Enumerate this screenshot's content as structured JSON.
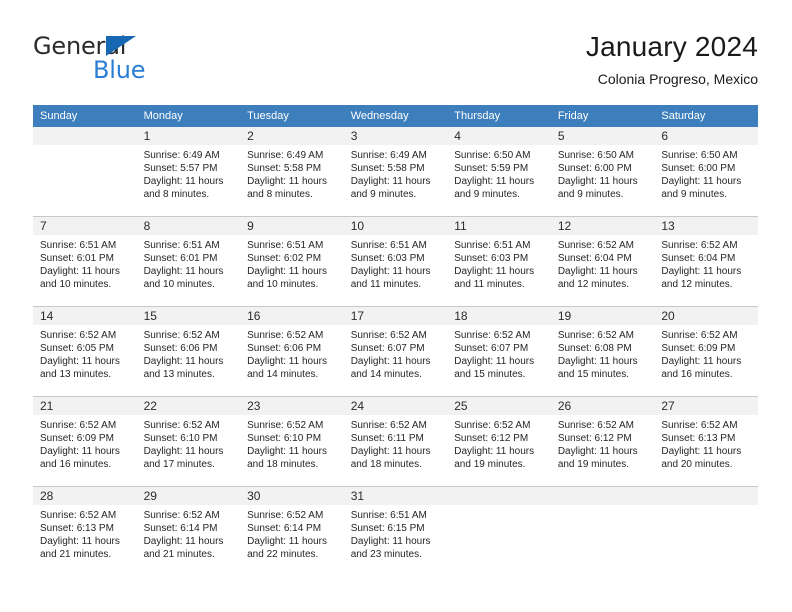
{
  "brand": {
    "name_part1": "General",
    "name_part2": "Blue",
    "accent_color": "#1668b3",
    "secondary_color": "#2a7fd4"
  },
  "header": {
    "title": "January 2024",
    "location": "Colonia Progreso, Mexico"
  },
  "theme": {
    "header_row_bg": "#3d7ebc",
    "daynum_band_bg": "#f2f2f2",
    "grid_line": "#c8c8c8",
    "text": "#262626"
  },
  "weekday_headers": [
    "Sunday",
    "Monday",
    "Tuesday",
    "Wednesday",
    "Thursday",
    "Friday",
    "Saturday"
  ],
  "weeks": [
    [
      {
        "day": "",
        "lines": []
      },
      {
        "day": "1",
        "lines": [
          "Sunrise: 6:49 AM",
          "Sunset: 5:57 PM",
          "Daylight: 11 hours",
          "and 8 minutes."
        ]
      },
      {
        "day": "2",
        "lines": [
          "Sunrise: 6:49 AM",
          "Sunset: 5:58 PM",
          "Daylight: 11 hours",
          "and 8 minutes."
        ]
      },
      {
        "day": "3",
        "lines": [
          "Sunrise: 6:49 AM",
          "Sunset: 5:58 PM",
          "Daylight: 11 hours",
          "and 9 minutes."
        ]
      },
      {
        "day": "4",
        "lines": [
          "Sunrise: 6:50 AM",
          "Sunset: 5:59 PM",
          "Daylight: 11 hours",
          "and 9 minutes."
        ]
      },
      {
        "day": "5",
        "lines": [
          "Sunrise: 6:50 AM",
          "Sunset: 6:00 PM",
          "Daylight: 11 hours",
          "and 9 minutes."
        ]
      },
      {
        "day": "6",
        "lines": [
          "Sunrise: 6:50 AM",
          "Sunset: 6:00 PM",
          "Daylight: 11 hours",
          "and 9 minutes."
        ]
      }
    ],
    [
      {
        "day": "7",
        "lines": [
          "Sunrise: 6:51 AM",
          "Sunset: 6:01 PM",
          "Daylight: 11 hours",
          "and 10 minutes."
        ]
      },
      {
        "day": "8",
        "lines": [
          "Sunrise: 6:51 AM",
          "Sunset: 6:01 PM",
          "Daylight: 11 hours",
          "and 10 minutes."
        ]
      },
      {
        "day": "9",
        "lines": [
          "Sunrise: 6:51 AM",
          "Sunset: 6:02 PM",
          "Daylight: 11 hours",
          "and 10 minutes."
        ]
      },
      {
        "day": "10",
        "lines": [
          "Sunrise: 6:51 AM",
          "Sunset: 6:03 PM",
          "Daylight: 11 hours",
          "and 11 minutes."
        ]
      },
      {
        "day": "11",
        "lines": [
          "Sunrise: 6:51 AM",
          "Sunset: 6:03 PM",
          "Daylight: 11 hours",
          "and 11 minutes."
        ]
      },
      {
        "day": "12",
        "lines": [
          "Sunrise: 6:52 AM",
          "Sunset: 6:04 PM",
          "Daylight: 11 hours",
          "and 12 minutes."
        ]
      },
      {
        "day": "13",
        "lines": [
          "Sunrise: 6:52 AM",
          "Sunset: 6:04 PM",
          "Daylight: 11 hours",
          "and 12 minutes."
        ]
      }
    ],
    [
      {
        "day": "14",
        "lines": [
          "Sunrise: 6:52 AM",
          "Sunset: 6:05 PM",
          "Daylight: 11 hours",
          "and 13 minutes."
        ]
      },
      {
        "day": "15",
        "lines": [
          "Sunrise: 6:52 AM",
          "Sunset: 6:06 PM",
          "Daylight: 11 hours",
          "and 13 minutes."
        ]
      },
      {
        "day": "16",
        "lines": [
          "Sunrise: 6:52 AM",
          "Sunset: 6:06 PM",
          "Daylight: 11 hours",
          "and 14 minutes."
        ]
      },
      {
        "day": "17",
        "lines": [
          "Sunrise: 6:52 AM",
          "Sunset: 6:07 PM",
          "Daylight: 11 hours",
          "and 14 minutes."
        ]
      },
      {
        "day": "18",
        "lines": [
          "Sunrise: 6:52 AM",
          "Sunset: 6:07 PM",
          "Daylight: 11 hours",
          "and 15 minutes."
        ]
      },
      {
        "day": "19",
        "lines": [
          "Sunrise: 6:52 AM",
          "Sunset: 6:08 PM",
          "Daylight: 11 hours",
          "and 15 minutes."
        ]
      },
      {
        "day": "20",
        "lines": [
          "Sunrise: 6:52 AM",
          "Sunset: 6:09 PM",
          "Daylight: 11 hours",
          "and 16 minutes."
        ]
      }
    ],
    [
      {
        "day": "21",
        "lines": [
          "Sunrise: 6:52 AM",
          "Sunset: 6:09 PM",
          "Daylight: 11 hours",
          "and 16 minutes."
        ]
      },
      {
        "day": "22",
        "lines": [
          "Sunrise: 6:52 AM",
          "Sunset: 6:10 PM",
          "Daylight: 11 hours",
          "and 17 minutes."
        ]
      },
      {
        "day": "23",
        "lines": [
          "Sunrise: 6:52 AM",
          "Sunset: 6:10 PM",
          "Daylight: 11 hours",
          "and 18 minutes."
        ]
      },
      {
        "day": "24",
        "lines": [
          "Sunrise: 6:52 AM",
          "Sunset: 6:11 PM",
          "Daylight: 11 hours",
          "and 18 minutes."
        ]
      },
      {
        "day": "25",
        "lines": [
          "Sunrise: 6:52 AM",
          "Sunset: 6:12 PM",
          "Daylight: 11 hours",
          "and 19 minutes."
        ]
      },
      {
        "day": "26",
        "lines": [
          "Sunrise: 6:52 AM",
          "Sunset: 6:12 PM",
          "Daylight: 11 hours",
          "and 19 minutes."
        ]
      },
      {
        "day": "27",
        "lines": [
          "Sunrise: 6:52 AM",
          "Sunset: 6:13 PM",
          "Daylight: 11 hours",
          "and 20 minutes."
        ]
      }
    ],
    [
      {
        "day": "28",
        "lines": [
          "Sunrise: 6:52 AM",
          "Sunset: 6:13 PM",
          "Daylight: 11 hours",
          "and 21 minutes."
        ]
      },
      {
        "day": "29",
        "lines": [
          "Sunrise: 6:52 AM",
          "Sunset: 6:14 PM",
          "Daylight: 11 hours",
          "and 21 minutes."
        ]
      },
      {
        "day": "30",
        "lines": [
          "Sunrise: 6:52 AM",
          "Sunset: 6:14 PM",
          "Daylight: 11 hours",
          "and 22 minutes."
        ]
      },
      {
        "day": "31",
        "lines": [
          "Sunrise: 6:51 AM",
          "Sunset: 6:15 PM",
          "Daylight: 11 hours",
          "and 23 minutes."
        ]
      },
      {
        "day": "",
        "lines": []
      },
      {
        "day": "",
        "lines": []
      },
      {
        "day": "",
        "lines": []
      }
    ]
  ]
}
